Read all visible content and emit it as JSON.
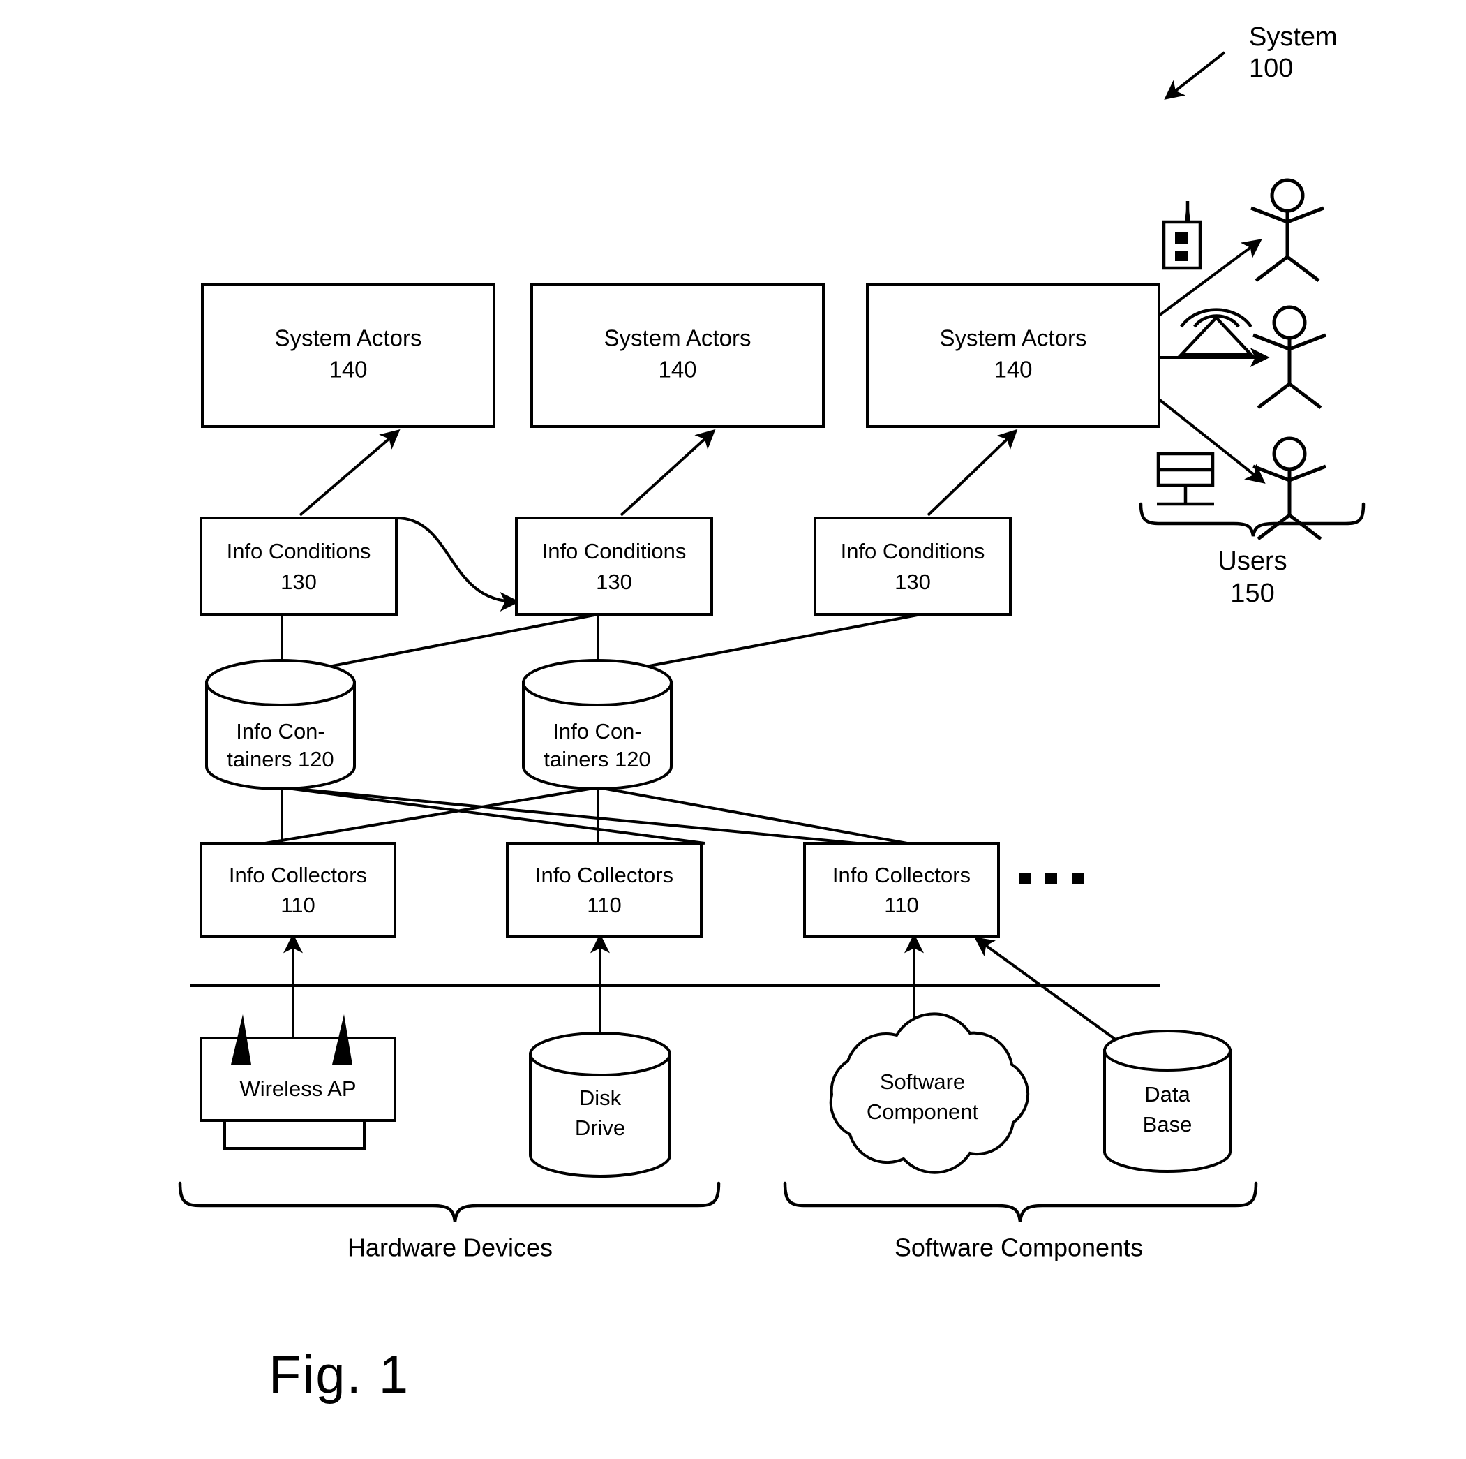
{
  "figure": {
    "caption": "Fig. 1",
    "system_label": "System",
    "system_ref": "100"
  },
  "nodes": {
    "system_actors": [
      {
        "title": "System Actors",
        "ref": "140"
      },
      {
        "title": "System Actors",
        "ref": "140"
      },
      {
        "title": "System Actors",
        "ref": "140"
      }
    ],
    "info_conditions": [
      {
        "title": "Info Conditions",
        "ref": "130"
      },
      {
        "title": "Info Conditions",
        "ref": "130"
      },
      {
        "title": "Info Conditions",
        "ref": "130"
      }
    ],
    "info_containers": [
      {
        "line1": "Info Con-",
        "line2": "tainers 120"
      },
      {
        "line1": "Info Con-",
        "line2": "tainers 120"
      }
    ],
    "info_collectors": [
      {
        "title": "Info Collectors",
        "ref": "110"
      },
      {
        "title": "Info Collectors",
        "ref": "110"
      },
      {
        "title": "Info Collectors",
        "ref": "110"
      }
    ],
    "ellipsis": "...",
    "sources": [
      {
        "name": "wireless-ap",
        "line1": "Wireless AP",
        "line2": ""
      },
      {
        "name": "disk-drive",
        "line1": "Disk",
        "line2": "Drive"
      },
      {
        "name": "software-component",
        "line1": "Software",
        "line2": "Component"
      },
      {
        "name": "database",
        "line1": "Data",
        "line2": "Base"
      }
    ]
  },
  "groups": {
    "hardware": "Hardware Devices",
    "software": "Software Components",
    "users_label": "Users",
    "users_ref": "150"
  },
  "user_endpoints": [
    {
      "device": "pager-icon",
      "actor": "stick-figure-icon"
    },
    {
      "device": "telephone-icon",
      "actor": "stick-figure-icon"
    },
    {
      "device": "computer-monitor-icon",
      "actor": "stick-figure-icon"
    }
  ],
  "colors": {
    "ink": "#000000",
    "paper": "#ffffff"
  }
}
